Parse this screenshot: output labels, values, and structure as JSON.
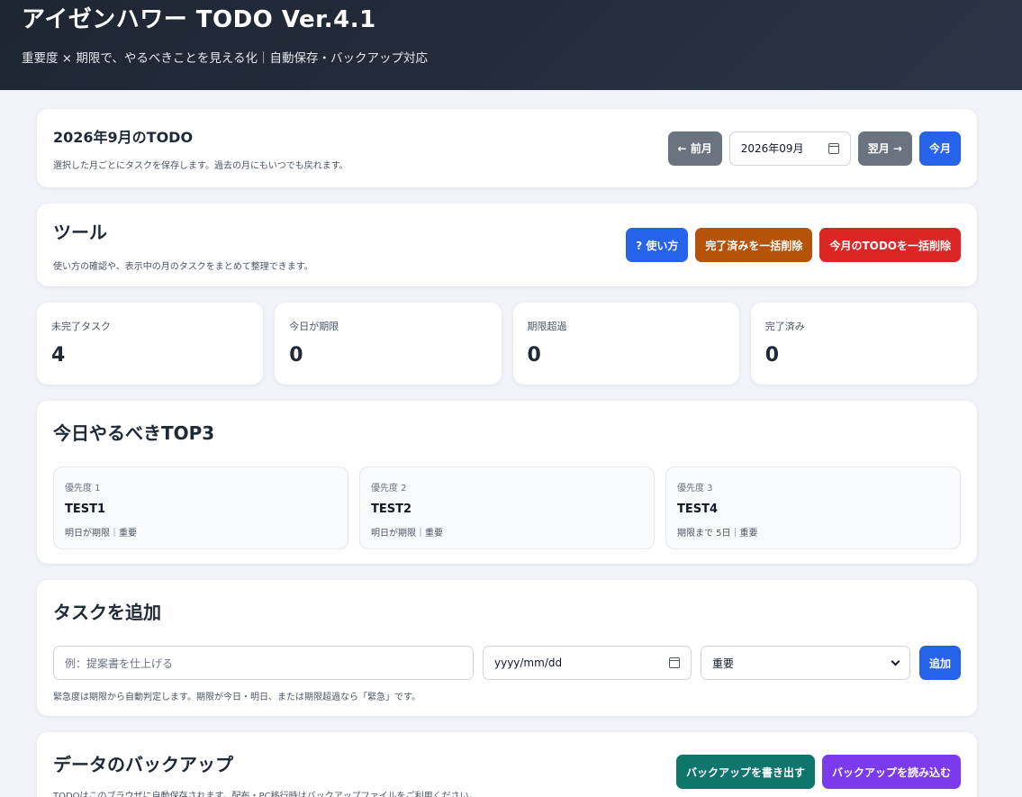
{
  "header": {
    "title": "アイゼンハワー TODO Ver.4.1",
    "subtitle": "重要度 × 期限で、やるべきことを見える化｜自動保存・バックアップ対応"
  },
  "month": {
    "title": "2026年9月のTODO",
    "desc": "選択した月ごとにタスクを保存します。過去の月にもいつでも戻れます。",
    "prev_label": "← 前月",
    "value": "2026年09月",
    "next_label": "翌月 →",
    "today_label": "今月"
  },
  "tools": {
    "title": "ツール",
    "desc": "使い方の確認や、表示中の月のタスクをまとめて整理できます。",
    "help_label": "? 使い方",
    "clear_done_label": "完了済みを一括削除",
    "clear_month_label": "今月のTODOを一括削除"
  },
  "stats": [
    {
      "label": "未完了タスク",
      "value": "4"
    },
    {
      "label": "今日が期限",
      "value": "0"
    },
    {
      "label": "期限超過",
      "value": "0"
    },
    {
      "label": "完了済み",
      "value": "0"
    }
  ],
  "top3": {
    "title": "今日やるべきTOP3",
    "items": [
      {
        "rank": "優先度 1",
        "name": "TEST1",
        "meta": "明日が期限｜重要"
      },
      {
        "rank": "優先度 2",
        "name": "TEST2",
        "meta": "明日が期限｜重要"
      },
      {
        "rank": "優先度 3",
        "name": "TEST4",
        "meta": "期限まで 5日｜重要"
      }
    ]
  },
  "add_task": {
    "title": "タスクを追加",
    "task_placeholder": "例：提案書を仕上げる",
    "date_placeholder": "yyyy/mm/dd",
    "importance_value": "重要",
    "add_label": "追加",
    "hint": "緊急度は期限から自動判定します。期限が今日・明日、または期限超過なら「緊急」です。"
  },
  "backup": {
    "title": "データのバックアップ",
    "desc": "TODOはこのブラウザに自動保存されます。配布・PC移行時はバックアップファイルをご利用ください。",
    "export_label": "バックアップを書き出す",
    "import_label": "バックアップを読み込む"
  }
}
